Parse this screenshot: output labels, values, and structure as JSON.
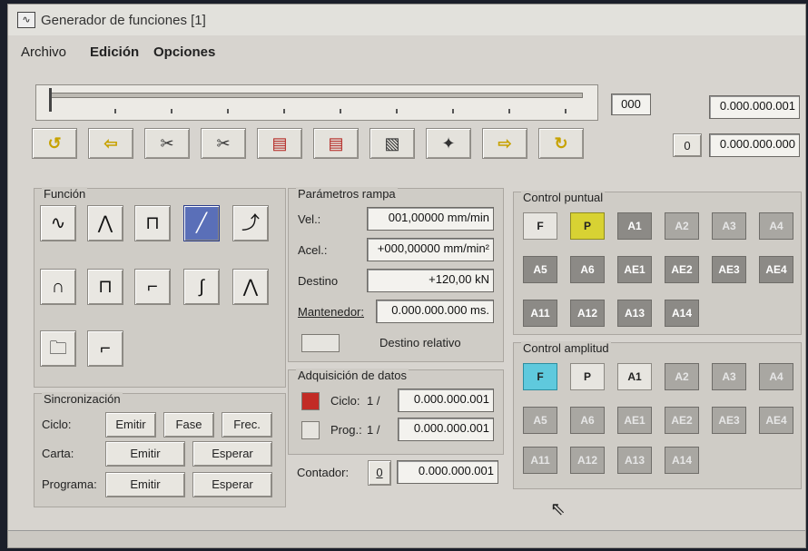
{
  "window": {
    "title": "Generador de funciones [1]",
    "icon": "waveform-icon"
  },
  "menu": [
    "Archivo",
    "Edición",
    "Opciones"
  ],
  "slider": {
    "value_box": "000"
  },
  "displays": {
    "top_value": "0.000.000.001",
    "bottom_value": "0.000.000.000",
    "zero_label": "0"
  },
  "toolbar": [
    {
      "icon": "undo-icon"
    },
    {
      "icon": "arrow-left-icon"
    },
    {
      "icon": "scissors-copy-icon"
    },
    {
      "icon": "scissors-paste-icon"
    },
    {
      "icon": "insert-page-icon"
    },
    {
      "icon": "delete-page-icon"
    },
    {
      "icon": "edit-page-icon"
    },
    {
      "icon": "sparkle-icon"
    },
    {
      "icon": "arrow-right-icon"
    },
    {
      "icon": "redo-icon"
    }
  ],
  "funcion": {
    "title": "Función",
    "buttons": [
      {
        "icon": "sine-wave-icon",
        "glyph": "∿"
      },
      {
        "icon": "triangle-wave-icon",
        "glyph": "⋀"
      },
      {
        "icon": "square-wave-icon",
        "glyph": "⊓"
      },
      {
        "icon": "ramp-icon",
        "glyph": "╱",
        "selected": true
      },
      {
        "icon": "curve-ramp-icon",
        "glyph": "⤴"
      },
      {
        "icon": "arch-icon",
        "glyph": "∩"
      },
      {
        "icon": "pulse-icon",
        "glyph": "⊓"
      },
      {
        "icon": "step-down-icon",
        "glyph": "⌐"
      },
      {
        "icon": "s-curve-icon",
        "glyph": "∫"
      },
      {
        "icon": "peak-icon",
        "glyph": "⋀"
      },
      {
        "icon": "folder-icon",
        "glyph": "🗀"
      },
      {
        "icon": "step-up-icon",
        "glyph": "⌐"
      }
    ]
  },
  "sincronizacion": {
    "title": "Sincronización",
    "rows": [
      {
        "label": "Ciclo:",
        "buttons": [
          "Emitir",
          "Fase",
          "Frec."
        ]
      },
      {
        "label": "Carta:",
        "buttons": [
          "Emitir",
          "Esperar"
        ]
      },
      {
        "label": "Programa:",
        "buttons": [
          "Emitir",
          "Esperar"
        ]
      }
    ]
  },
  "rampa": {
    "title": "Parámetros rampa",
    "vel_label": "Vel.:",
    "vel_value": "001,00000 mm/min",
    "acel_label": "Acel.:",
    "acel_value": "+000,00000 mm/min²",
    "destino_label": "Destino",
    "destino_value": "+120,00 kN",
    "mantenedor_label": "Mantenedor:",
    "mantenedor_value": "0.000.000.000 ms.",
    "destino_relativo": "Destino relativo"
  },
  "adquisicion": {
    "title": "Adquisición de datos",
    "ciclo_label": "Ciclo:",
    "ciclo_num": "1 /",
    "ciclo_value": "0.000.000.001",
    "prog_label": "Prog.:",
    "prog_num": "1 /",
    "prog_value": "0.000.000.001"
  },
  "contador": {
    "label": "Contador:",
    "button": "0",
    "value": "0.000.000.001"
  },
  "control_puntual": {
    "title": "Control puntual",
    "buttons": [
      "F",
      "P",
      "A1",
      "A2",
      "A3",
      "A4",
      "A5",
      "A6",
      "AE1",
      "AE2",
      "AE3",
      "AE4",
      "A11",
      "A12",
      "A13",
      "A14"
    ]
  },
  "control_amplitud": {
    "title": "Control amplitud",
    "buttons": [
      "F",
      "P",
      "A1",
      "A2",
      "A3",
      "A4",
      "A5",
      "A6",
      "AE1",
      "AE2",
      "AE3",
      "AE4",
      "A11",
      "A12",
      "A13",
      "A14"
    ]
  }
}
